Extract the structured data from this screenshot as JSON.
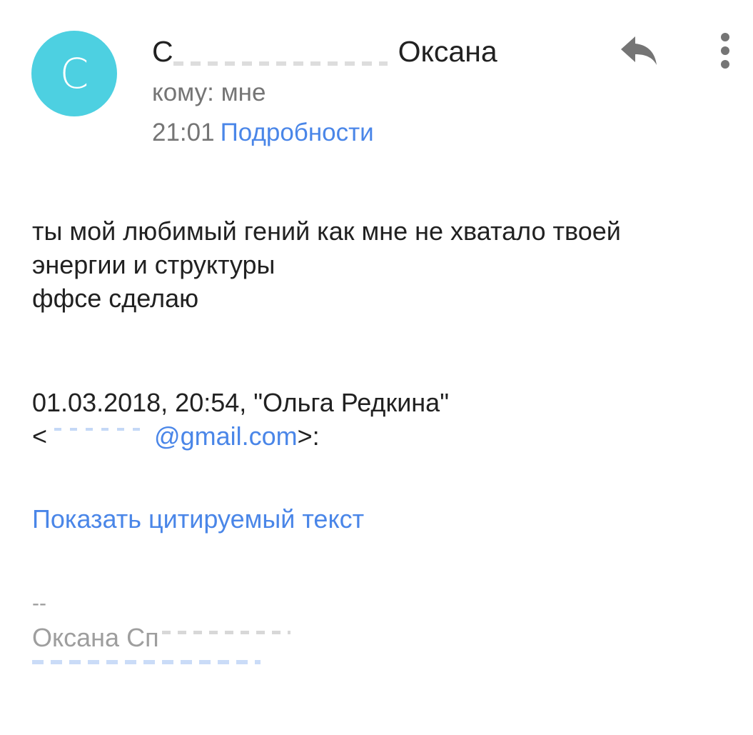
{
  "header": {
    "avatar_letter": "C",
    "avatar_color": "#4dd0e1",
    "sender_first": "С",
    "sender_last": "Оксана",
    "to_line": "кому: мне",
    "time": "21:01",
    "details_label": "Подробности",
    "reply_icon": "reply-icon",
    "more_icon": "more-vert-icon"
  },
  "body": {
    "lines": [
      "ты мой любимый гений как мне не хватало твоей",
      "энергии и структуры",
      "ффсе сделаю"
    ]
  },
  "quote": {
    "header_line": "01.03.2018, 20:54, \"Ольга Редкина\"",
    "email_prefix": "<",
    "email_visible": "@gmail.com",
    "email_suffix": ">:",
    "show_quoted_label": "Показать цитируемый текст"
  },
  "signature": {
    "separator": "--",
    "name_visible": "Оксана Сп"
  },
  "colors": {
    "link": "#4a86e8",
    "primary_text": "#212121",
    "secondary_text": "#757575",
    "icon": "#757575"
  }
}
